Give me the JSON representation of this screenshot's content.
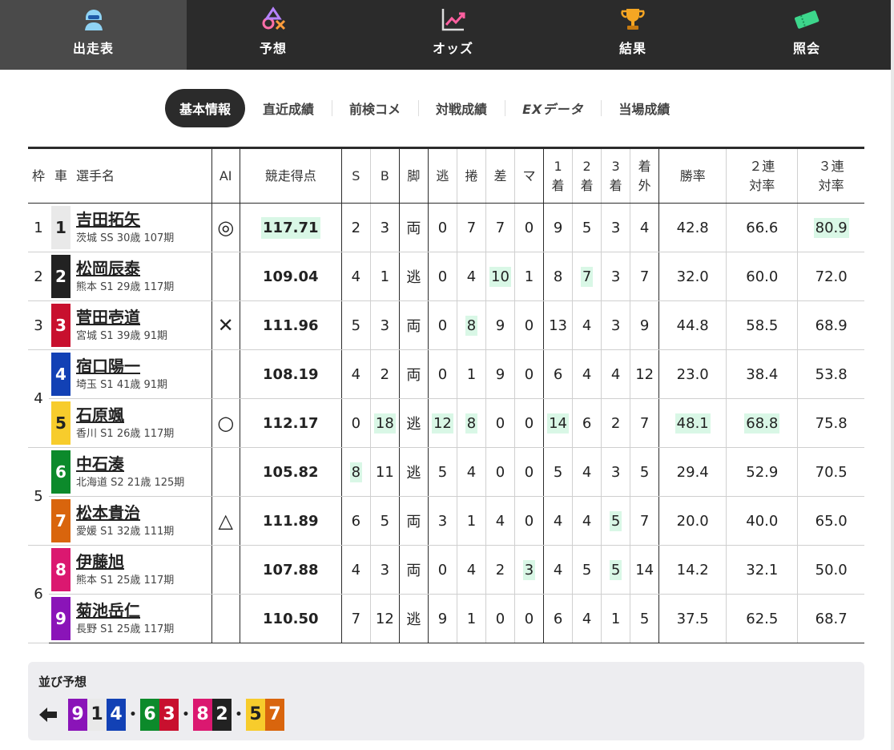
{
  "nav": [
    {
      "label": "出走表",
      "icon": "racer-icon",
      "active": true
    },
    {
      "label": "予想",
      "icon": "prediction-icon",
      "active": false
    },
    {
      "label": "オッズ",
      "icon": "odds-chart-icon",
      "active": false
    },
    {
      "label": "結果",
      "icon": "trophy-icon",
      "active": false
    },
    {
      "label": "照会",
      "icon": "ticket-icon",
      "active": false
    }
  ],
  "tabs": [
    {
      "label": "基本情報",
      "active": true
    },
    {
      "label": "直近成績",
      "active": false
    },
    {
      "label": "前検コメ",
      "active": false
    },
    {
      "label": "対戦成績",
      "active": false
    },
    {
      "label": "EXデータ",
      "active": false
    },
    {
      "label": "当場成績",
      "active": false
    }
  ],
  "headers": {
    "waku": "枠",
    "car": "車",
    "name": "選手名",
    "ai": "AI",
    "score": "競走得点",
    "s": "S",
    "b": "B",
    "kyaku": "脚",
    "nige": "逃",
    "makuri": "捲",
    "sashi": "差",
    "ma": "マ",
    "first1": "1",
    "first2": "着",
    "second1": "2",
    "second2": "着",
    "third1": "3",
    "third2": "着",
    "out1": "着",
    "out2": "外",
    "win": "勝率",
    "quin1": "２連",
    "quin2": "対率",
    "tri1": "３連",
    "tri2": "対率"
  },
  "colors": {
    "car1": "#e9e9e9",
    "car2": "#222222",
    "car3": "#c8102e",
    "car4": "#1241b5",
    "car5": "#f7cc2c",
    "car6": "#0c8a2b",
    "car7": "#d9650d",
    "car8": "#db1870",
    "car9": "#8a14b8",
    "highlight": "#d9f7e6",
    "nav_bg": "#2b2b2b"
  },
  "waku_groups": [
    {
      "label": "1",
      "span": 1
    },
    {
      "label": "2",
      "span": 1
    },
    {
      "label": "3",
      "span": 1
    },
    {
      "label": "4",
      "span": 2
    },
    {
      "label": "5",
      "span": 2
    },
    {
      "label": "6",
      "span": 2
    }
  ],
  "rows": [
    {
      "car": "1",
      "name": "吉田拓矢",
      "info": "茨城 SS 30歳 107期",
      "ai": "◎",
      "score": "117.71",
      "s": "2",
      "b": "3",
      "kyaku": "両",
      "nige": "0",
      "makuri": "7",
      "sashi": "7",
      "ma": "0",
      "first": "9",
      "second": "5",
      "third": "3",
      "out": "4",
      "win": "42.8",
      "quin": "66.6",
      "tri": "80.9",
      "hl": [
        "score",
        "tri"
      ]
    },
    {
      "car": "2",
      "name": "松岡辰泰",
      "info": "熊本 S1 29歳 117期",
      "ai": "",
      "score": "109.04",
      "s": "4",
      "b": "1",
      "kyaku": "逃",
      "nige": "0",
      "makuri": "4",
      "sashi": "10",
      "ma": "1",
      "first": "8",
      "second": "7",
      "third": "3",
      "out": "7",
      "win": "32.0",
      "quin": "60.0",
      "tri": "72.0",
      "hl": [
        "sashi",
        "second"
      ]
    },
    {
      "car": "3",
      "name": "菅田壱道",
      "info": "宮城 S1 39歳 91期",
      "ai": "✕",
      "score": "111.96",
      "s": "5",
      "b": "3",
      "kyaku": "両",
      "nige": "0",
      "makuri": "8",
      "sashi": "9",
      "ma": "0",
      "first": "13",
      "second": "4",
      "third": "3",
      "out": "9",
      "win": "44.8",
      "quin": "58.5",
      "tri": "68.9",
      "hl": [
        "makuri"
      ]
    },
    {
      "car": "4",
      "name": "宿口陽一",
      "info": "埼玉 S1 41歳 91期",
      "ai": "",
      "score": "108.19",
      "s": "4",
      "b": "2",
      "kyaku": "両",
      "nige": "0",
      "makuri": "1",
      "sashi": "9",
      "ma": "0",
      "first": "6",
      "second": "4",
      "third": "4",
      "out": "12",
      "win": "23.0",
      "quin": "38.4",
      "tri": "53.8",
      "hl": []
    },
    {
      "car": "5",
      "name": "石原颯",
      "info": "香川 S1 26歳 117期",
      "ai": "○",
      "score": "112.17",
      "s": "0",
      "b": "18",
      "kyaku": "逃",
      "nige": "12",
      "makuri": "8",
      "sashi": "0",
      "ma": "0",
      "first": "14",
      "second": "6",
      "third": "2",
      "out": "7",
      "win": "48.1",
      "quin": "68.8",
      "tri": "75.8",
      "hl": [
        "b",
        "nige",
        "makuri",
        "first",
        "win",
        "quin"
      ]
    },
    {
      "car": "6",
      "name": "中石湊",
      "info": "北海道 S2 21歳 125期",
      "ai": "",
      "score": "105.82",
      "s": "8",
      "b": "11",
      "kyaku": "逃",
      "nige": "5",
      "makuri": "4",
      "sashi": "0",
      "ma": "0",
      "first": "5",
      "second": "4",
      "third": "3",
      "out": "5",
      "win": "29.4",
      "quin": "52.9",
      "tri": "70.5",
      "hl": [
        "s"
      ]
    },
    {
      "car": "7",
      "name": "松本貴治",
      "info": "愛媛 S1 32歳 111期",
      "ai": "△",
      "score": "111.89",
      "s": "6",
      "b": "5",
      "kyaku": "両",
      "nige": "3",
      "makuri": "1",
      "sashi": "4",
      "ma": "0",
      "first": "4",
      "second": "4",
      "third": "5",
      "out": "7",
      "win": "20.0",
      "quin": "40.0",
      "tri": "65.0",
      "hl": [
        "third"
      ]
    },
    {
      "car": "8",
      "name": "伊藤旭",
      "info": "熊本 S1 25歳 117期",
      "ai": "",
      "score": "107.88",
      "s": "4",
      "b": "3",
      "kyaku": "両",
      "nige": "0",
      "makuri": "4",
      "sashi": "2",
      "ma": "3",
      "first": "4",
      "second": "5",
      "third": "5",
      "out": "14",
      "win": "14.2",
      "quin": "32.1",
      "tri": "50.0",
      "hl": [
        "ma",
        "third"
      ]
    },
    {
      "car": "9",
      "name": "菊池岳仁",
      "info": "長野 S1 25歳 117期",
      "ai": "",
      "score": "110.50",
      "s": "7",
      "b": "12",
      "kyaku": "逃",
      "nige": "9",
      "makuri": "1",
      "sashi": "0",
      "ma": "0",
      "first": "6",
      "second": "4",
      "third": "1",
      "out": "5",
      "win": "37.5",
      "quin": "62.5",
      "tri": "68.7",
      "hl": []
    }
  ],
  "narabi": {
    "title": "並び予想",
    "groups": [
      [
        "9",
        "1",
        "4"
      ],
      [
        "6",
        "3"
      ],
      [
        "8",
        "2"
      ],
      [
        "5",
        "7"
      ]
    ],
    "separator": "•"
  }
}
